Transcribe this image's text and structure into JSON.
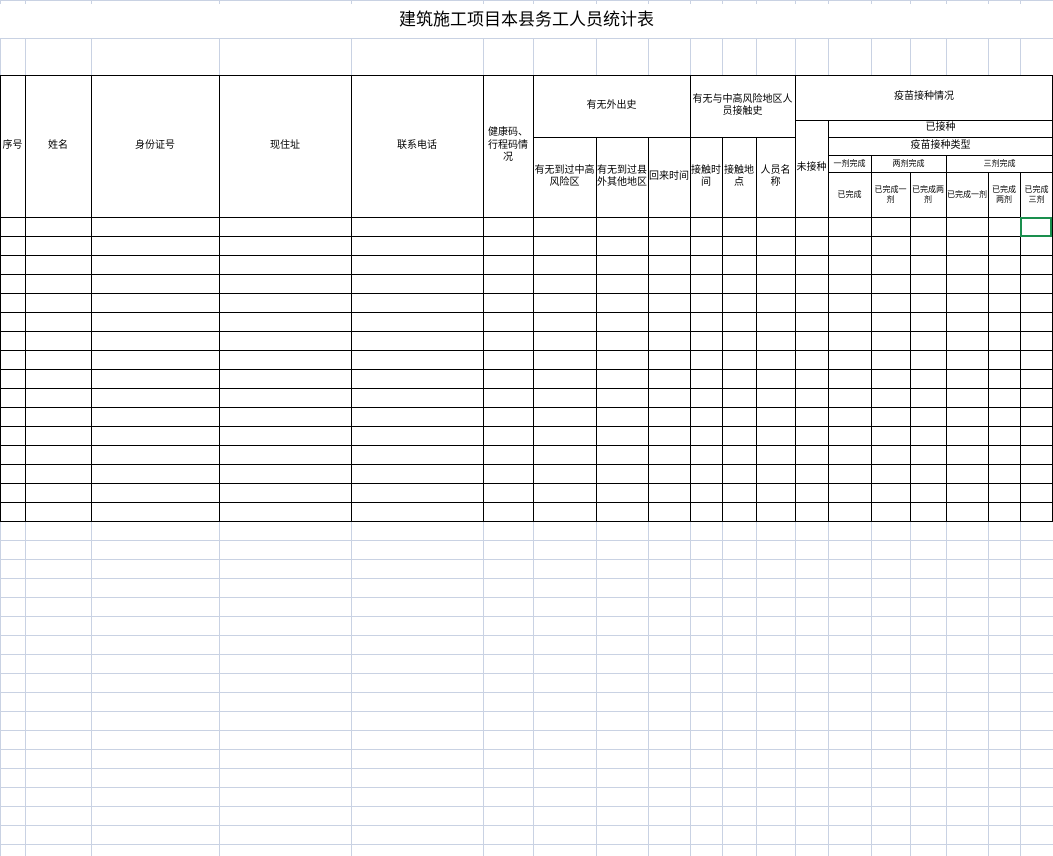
{
  "sheet": {
    "title": "建筑施工项目本县务工人员统计表",
    "headers": {
      "seq": "序号",
      "name": "姓名",
      "id": "身份证号",
      "address": "现住址",
      "phone": "联系电话",
      "health": "健康码、行程码情况",
      "travel_group": "有无外出史",
      "travel_high_risk": "有无到过中高风险区",
      "travel_other": "有无到过县外其他地区",
      "return_time": "回来时间",
      "contact_group": "有无与中高风险地区人员接触史",
      "contact_time": "接触时间",
      "contact_place": "接触地点",
      "contact_person": "人员名称",
      "vaccine_group": "疫苗接种情况",
      "vaccinated": "已接种",
      "vaccine_type": "疫苗接种类型",
      "not_vaccinated": "未接种",
      "one_dose": "一剂完成",
      "two_dose": "两剂完成",
      "three_dose": "三剂完成",
      "one_done": "已完成",
      "two_done1": "已完成一剂",
      "two_done2": "已完成两剂",
      "three_done1": "已完成一剂",
      "three_done2": "已完成两剂",
      "three_done3": "已完成三剂"
    },
    "data_rows": 16
  }
}
